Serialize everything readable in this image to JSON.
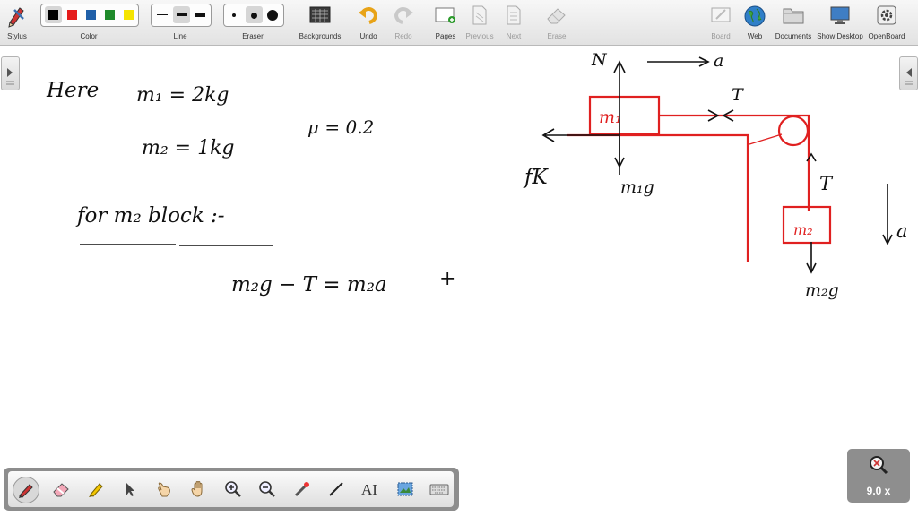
{
  "toolbar": {
    "stylus": "Stylus",
    "color": "Color",
    "line": "Line",
    "eraser": "Eraser",
    "backgrounds": "Backgrounds",
    "undo": "Undo",
    "redo": "Redo",
    "pages": "Pages",
    "previous": "Previous",
    "next": "Next",
    "erase": "Erase",
    "board": "Board",
    "web": "Web",
    "documents": "Documents",
    "show_desktop": "Show Desktop",
    "openboard": "OpenBoard"
  },
  "colors": {
    "black": "#000000",
    "red": "#e51c1c",
    "blue": "#1f5fa8",
    "green": "#1f8a2b",
    "yellow": "#f5e400",
    "ink": "#111111",
    "diagram_red": "#e02020"
  },
  "notes": {
    "here": "Here",
    "m1": "m₁ = 2kg",
    "m2": "m₂ = 1kg",
    "mu": "μ = 0.2",
    "for_block": "for m₂ block :-",
    "equation": "m₂g − T = m₂a",
    "plus": "+"
  },
  "diagram": {
    "N": "N",
    "a_top": "a",
    "T_top": "T",
    "m1": "m₁",
    "fk": "fK",
    "m1g": "m₁g",
    "T_right": "T",
    "m2": "m₂",
    "a_right": "a",
    "m2g": "m₂g"
  },
  "zoom": {
    "text": "9.0 x"
  }
}
